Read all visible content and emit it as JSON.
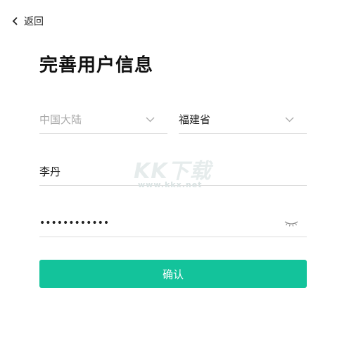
{
  "header": {
    "back_label": "返回"
  },
  "page": {
    "title": "完善用户信息"
  },
  "form": {
    "region": {
      "placeholder": "中国大陆"
    },
    "province": {
      "value": "福建省"
    },
    "name": {
      "value": "李丹"
    },
    "password": {
      "masked_value": "••••••••••••"
    },
    "confirm_label": "确认"
  },
  "watermark": {
    "title": "KK下载",
    "url": "www.kkx.net"
  },
  "colors": {
    "accent": "#13c39b",
    "divider": "#dcdcdc",
    "placeholder": "#a9a9a9"
  },
  "icons": {
    "back": "chevron-left-icon",
    "dropdown": "chevron-down-icon",
    "password_toggle": "eye-closed-icon"
  }
}
